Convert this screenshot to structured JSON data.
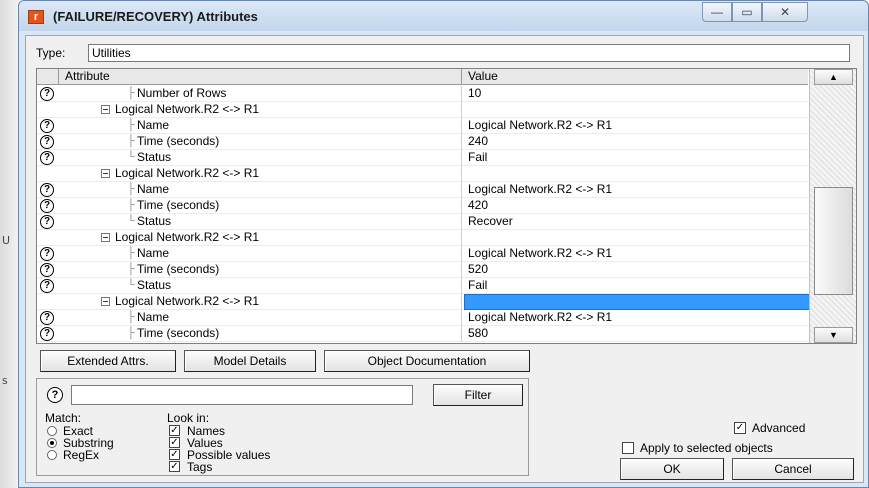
{
  "window": {
    "title": "(FAILURE/RECOVERY) Attributes",
    "app_icon_glyph": "r",
    "minimize_glyph": "—",
    "maximize_glyph": "▭",
    "close_glyph": "✕"
  },
  "type_label": "Type:",
  "type_value": "Utilities",
  "grid": {
    "col_attribute": "Attribute",
    "col_value": "Value",
    "scroll_up_glyph": "▲",
    "scroll_down_glyph": "▼",
    "rows": [
      {
        "attr": "Number of Rows",
        "value": "10",
        "q": true,
        "indent": 2,
        "kind": "leaf"
      },
      {
        "attr": "Logical Network.R2 <-> R1",
        "value": "",
        "q": false,
        "indent": 1,
        "kind": "group"
      },
      {
        "attr": "Name",
        "value": "Logical Network.R2 <-> R1",
        "q": true,
        "indent": 2,
        "kind": "leaf"
      },
      {
        "attr": "Time (seconds)",
        "value": "240",
        "q": true,
        "indent": 2,
        "kind": "leaf"
      },
      {
        "attr": "Status",
        "value": "Fail",
        "q": true,
        "indent": 2,
        "kind": "last"
      },
      {
        "attr": "Logical Network.R2 <-> R1",
        "value": "",
        "q": false,
        "indent": 1,
        "kind": "group"
      },
      {
        "attr": "Name",
        "value": "Logical Network.R2 <-> R1",
        "q": true,
        "indent": 2,
        "kind": "leaf"
      },
      {
        "attr": "Time (seconds)",
        "value": "420",
        "q": true,
        "indent": 2,
        "kind": "leaf"
      },
      {
        "attr": "Status",
        "value": "Recover",
        "q": true,
        "indent": 2,
        "kind": "last"
      },
      {
        "attr": "Logical Network.R2 <-> R1",
        "value": "",
        "q": false,
        "indent": 1,
        "kind": "group"
      },
      {
        "attr": "Name",
        "value": "Logical Network.R2 <-> R1",
        "q": true,
        "indent": 2,
        "kind": "leaf"
      },
      {
        "attr": "Time (seconds)",
        "value": "520",
        "q": true,
        "indent": 2,
        "kind": "leaf"
      },
      {
        "attr": "Status",
        "value": "Fail",
        "q": true,
        "indent": 2,
        "kind": "last"
      },
      {
        "attr": "Logical Network.R2 <-> R1",
        "value": "",
        "q": false,
        "indent": 1,
        "kind": "group",
        "selected": true
      },
      {
        "attr": "Name",
        "value": "Logical Network.R2 <-> R1",
        "q": true,
        "indent": 2,
        "kind": "leaf"
      },
      {
        "attr": "Time (seconds)",
        "value": "580",
        "q": true,
        "indent": 2,
        "kind": "leaf"
      }
    ]
  },
  "buttons": {
    "extended_attrs": "Extended Attrs.",
    "model_details": "Model Details",
    "object_documentation": "Object Documentation",
    "filter": "Filter",
    "ok": "OK",
    "cancel": "Cancel"
  },
  "filter": {
    "search_value": "",
    "match_label": "Match:",
    "look_in_label": "Look in:",
    "match_options": [
      {
        "label": "Exact",
        "selected": false
      },
      {
        "label": "Substring",
        "selected": true
      },
      {
        "label": "RegEx",
        "selected": false
      }
    ],
    "look_in_options": [
      {
        "label": "Names",
        "checked": true
      },
      {
        "label": "Values",
        "checked": true
      },
      {
        "label": "Possible values",
        "checked": true
      },
      {
        "label": "Tags",
        "checked": true
      }
    ]
  },
  "options": {
    "advanced": {
      "label": "Advanced",
      "checked": true
    },
    "apply_selected": {
      "label": "Apply to selected objects",
      "checked": false
    }
  },
  "icons": {
    "help": "?",
    "check": "✓"
  },
  "background_marks": [
    "U",
    "s"
  ]
}
